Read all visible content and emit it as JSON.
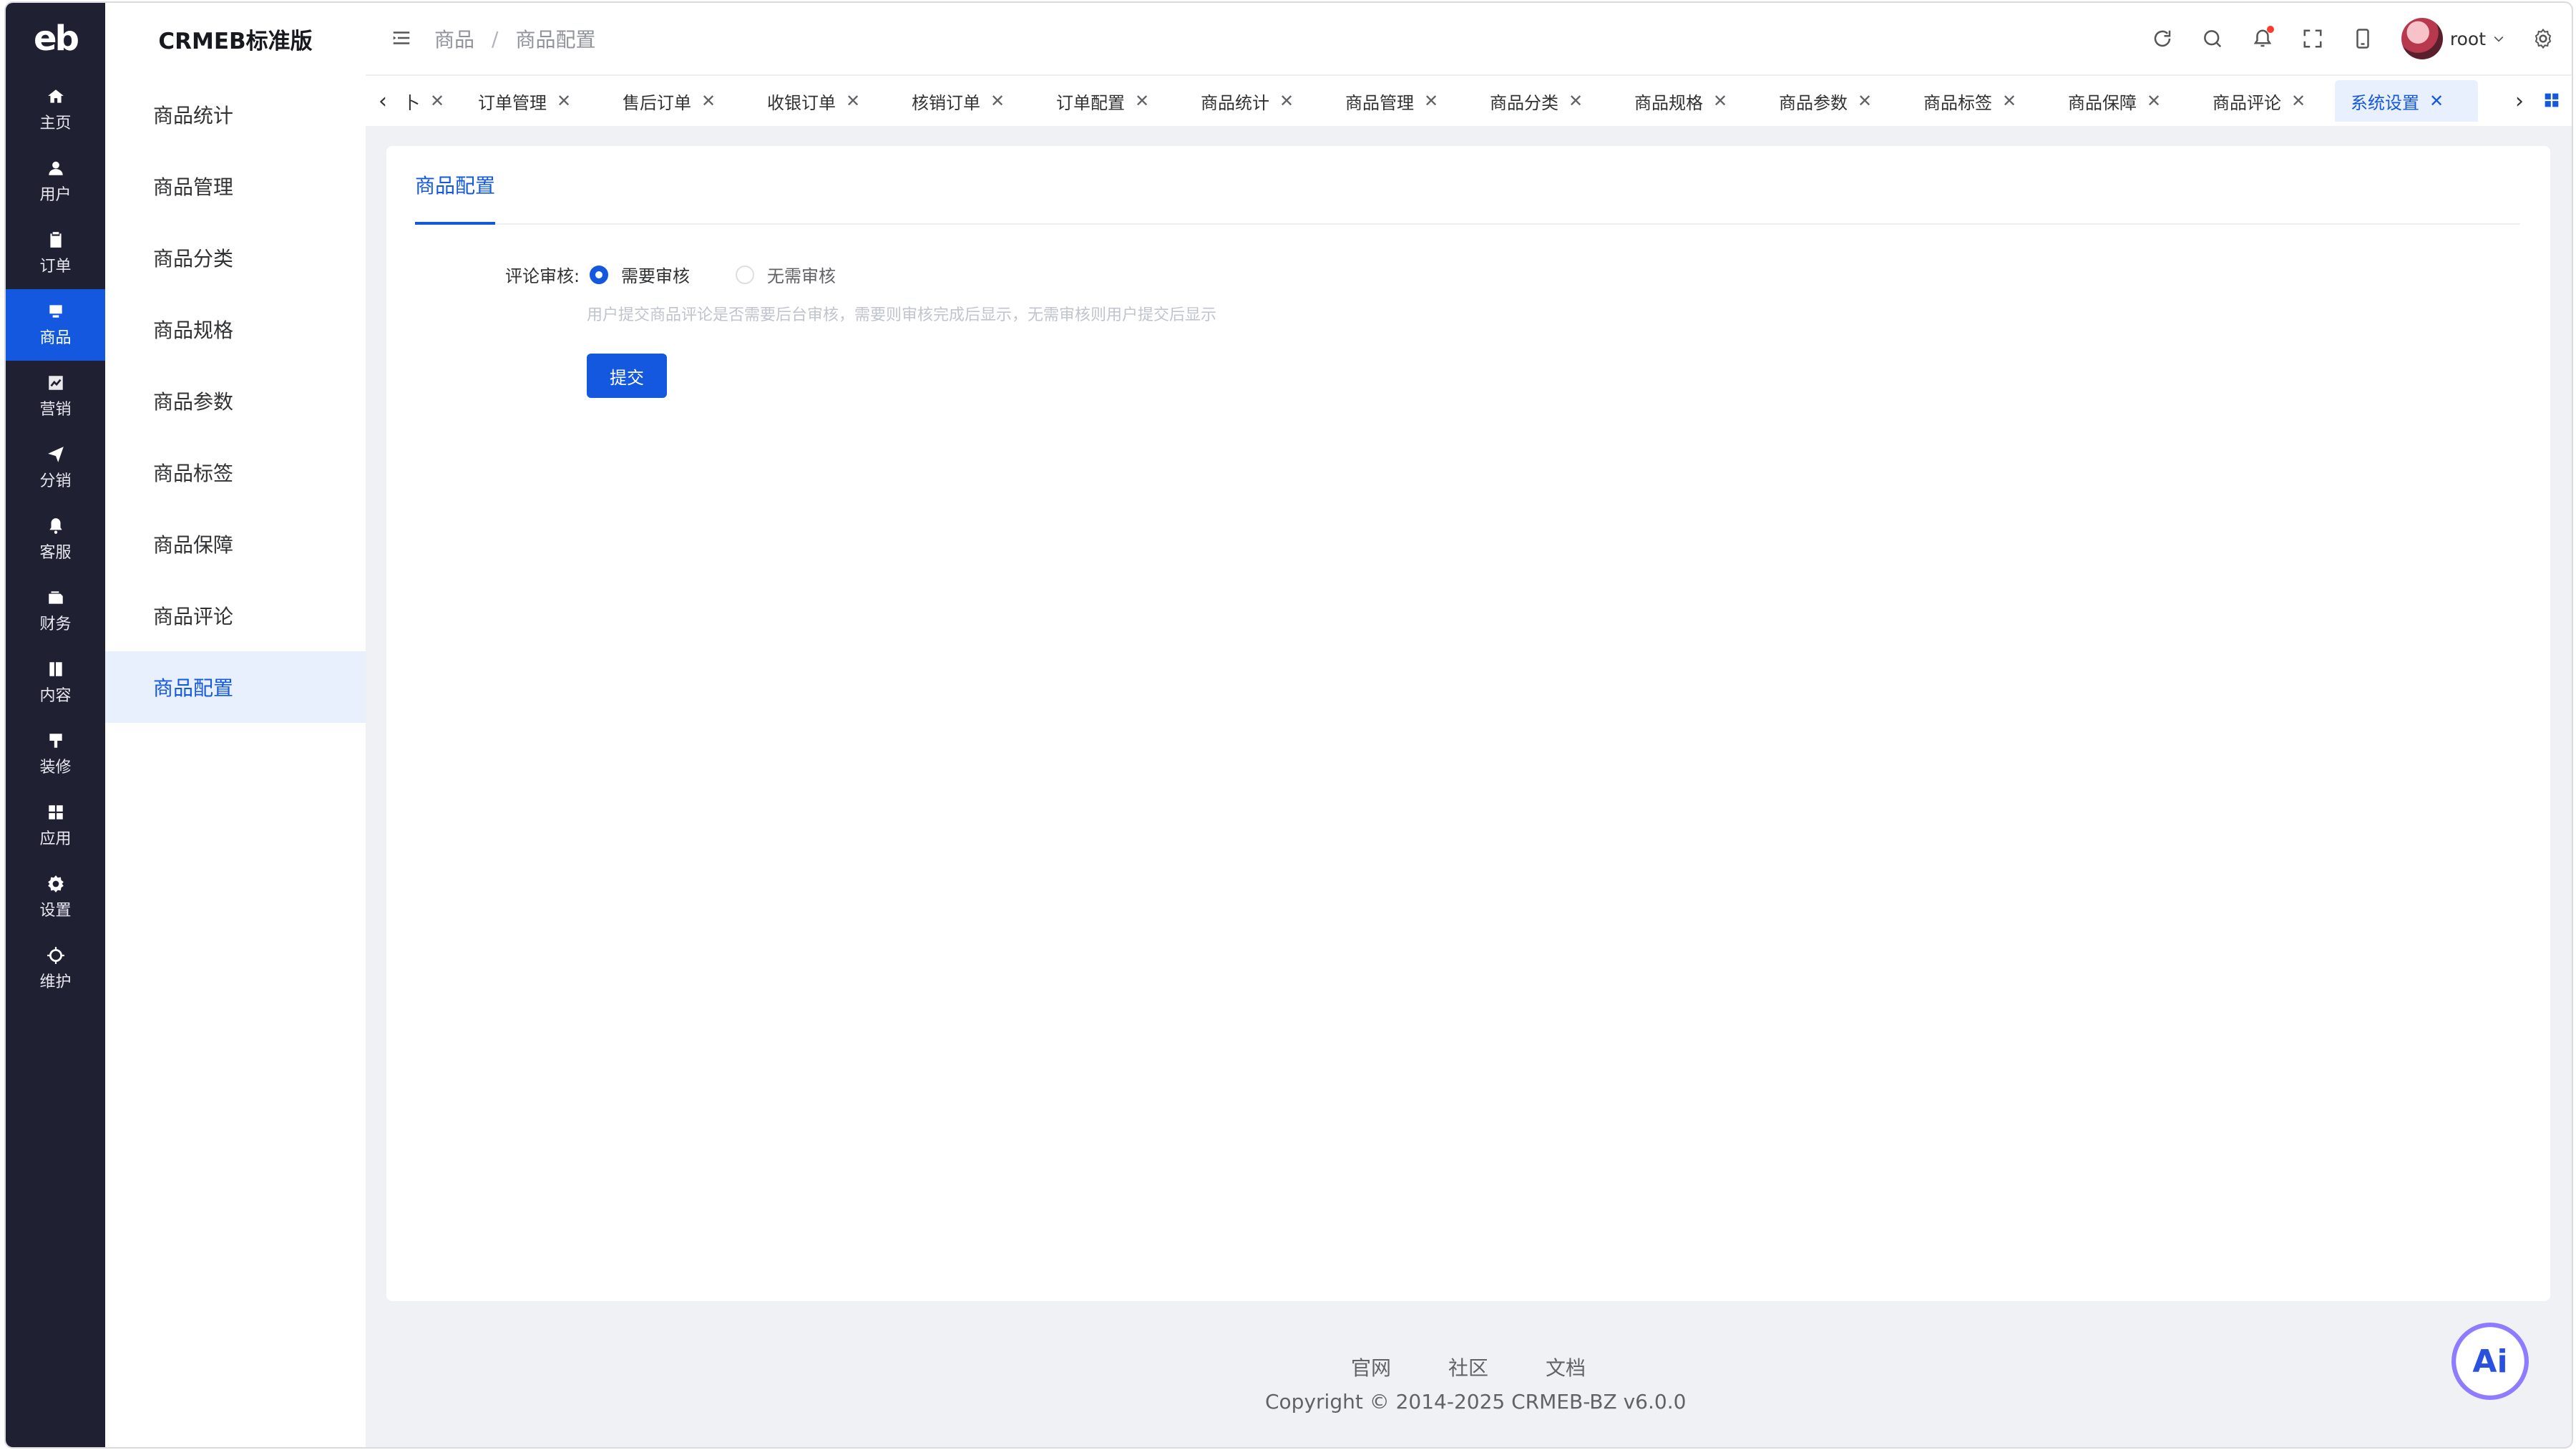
{
  "rail": {
    "logo": "eb",
    "items": [
      "主页",
      "用户",
      "订单",
      "商品",
      "营销",
      "分销",
      "客服",
      "财务",
      "内容",
      "装修",
      "应用",
      "设置",
      "维护"
    ]
  },
  "sidebar": {
    "title": "CRMEB标准版",
    "items": [
      "商品统计",
      "商品管理",
      "商品分类",
      "商品规格",
      "商品参数",
      "商品标签",
      "商品保障",
      "商品评论",
      "商品配置"
    ]
  },
  "header": {
    "breadcrumb": [
      "商品",
      "商品配置"
    ],
    "username": "root"
  },
  "tabs": {
    "first_partial": "卜",
    "items": [
      "订单管理",
      "售后订单",
      "收银订单",
      "核销订单",
      "订单配置",
      "商品统计",
      "商品管理",
      "商品分类",
      "商品规格",
      "商品参数",
      "商品标签",
      "商品保障",
      "商品评论",
      "系统设置"
    ]
  },
  "content": {
    "tab_label": "商品配置",
    "field_label": "评论审核:",
    "option_required": "需要审核",
    "option_not_required": "无需审核",
    "hint": "用户提交商品评论是否需要后台审核，需要则审核完成后显示，无需审核则用户提交后显示",
    "submit_label": "提交"
  },
  "footer": {
    "links": [
      "官网",
      "社区",
      "文档"
    ],
    "copyright": "Copyright © 2014-2025 CRMEB-BZ v6.0.0"
  },
  "ai_button": {
    "label": "Ai"
  },
  "colors": {
    "accent": "#1458e0",
    "rail_bg": "#1f2133"
  }
}
